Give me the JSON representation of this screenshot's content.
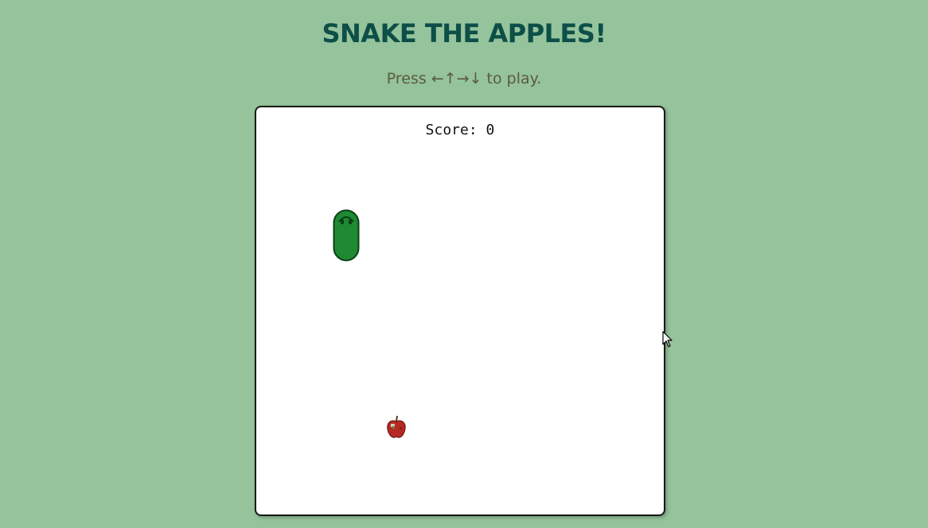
{
  "header": {
    "title": "SNAKE THE APPLES!",
    "instructions": "Press ←↑→↓ to play."
  },
  "game": {
    "score_label": "Score:",
    "score": 0,
    "score_text": "Score: 0",
    "snake_direction": "up",
    "snake_length_segments": 2
  },
  "colors": {
    "background": "#95c39b",
    "title": "#0d4f48",
    "instructions": "#5b5a3e",
    "board": "#ffffff",
    "board_border": "#161a12",
    "snake_body": "#1e8a32",
    "snake_outline": "#0c3f17",
    "apple": "#b52a24"
  },
  "icons": {
    "snake": "snake-icon",
    "apple": "apple-icon",
    "cursor": "mouse-cursor-icon"
  }
}
